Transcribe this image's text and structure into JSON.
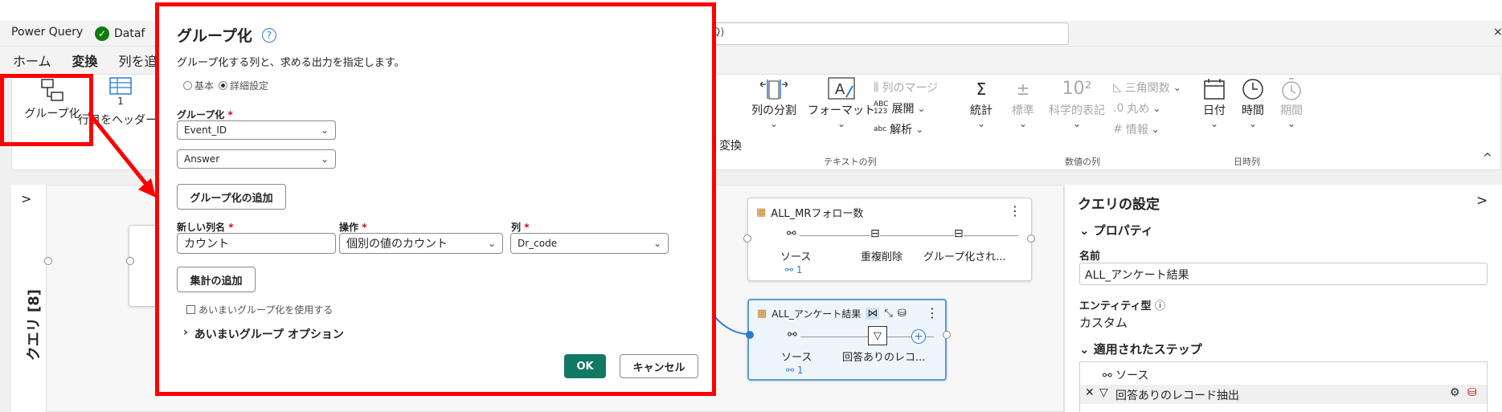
{
  "titlebar": {
    "app_tab": "Power Query",
    "doc_tab": "Dataf",
    "search_hint": "+ Q)",
    "close": "×"
  },
  "menu": {
    "items": [
      "ホーム",
      "変換",
      "列を追"
    ],
    "active_index": 1
  },
  "ribbon": {
    "group_by": "グループ化",
    "use_headers_partial": "行目をヘッダー",
    "use_headers_num": "1",
    "convert_partial": "変換",
    "split_column": "列の分割",
    "format": "フォーマット",
    "merge_columns": "列のマージ",
    "extract": "展開",
    "parse": "解析",
    "text_group": "テキストの列",
    "statistics": "統計",
    "standard": "標準",
    "scientific": "科学的表記",
    "trig": "三角関数",
    "rounding": "丸め",
    "information": "情報",
    "number_group": "数値の列",
    "date": "日付",
    "time": "時間",
    "duration": "期間",
    "datetime_group": "日時列",
    "collapse": "^"
  },
  "left_pane": {
    "label": "クエリ [8]",
    "expand": ">"
  },
  "nodes": {
    "mr": {
      "title": "ALL_MRフォロー数",
      "steps": [
        "ソース",
        "重複削除",
        "グループ化され..."
      ],
      "link_count": "1",
      "menu": "⋮"
    },
    "survey": {
      "title": "ALL_アンケート結果",
      "steps": [
        "ソース",
        "回答ありのレコ..."
      ],
      "link_count": "1",
      "menu": "⋮"
    }
  },
  "settings": {
    "title": "クエリの設定",
    "expand": ">",
    "properties": "プロパティ",
    "name_label": "名前",
    "name_value": "ALL_アンケート結果",
    "entity_label": "エンティティ型",
    "entity_value": "カスタム",
    "applied_steps": "適用されたステップ",
    "steps": [
      "ソース",
      "回答ありのレコード抽出"
    ]
  },
  "dialog": {
    "title": "グループ化",
    "subtitle": "グループ化する列と、求める出力を指定します。",
    "radio_basic": "基本",
    "radio_advanced": "詳細設定",
    "group_label": "グループ化",
    "group_col1": "Event_ID",
    "group_col2": "Answer",
    "add_grouping": "グループ化の追加",
    "new_col_label": "新しい列名",
    "op_label": "操作",
    "col_label": "列",
    "new_col_value": "カウント",
    "op_value": "個別の値のカウント",
    "col_value": "Dr_code",
    "add_aggregation": "集計の追加",
    "fuzzy_check": "あいまいグループ化を使用する",
    "fuzzy_options": "あいまいグループ オプション",
    "ok": "OK",
    "cancel": "キャンセル",
    "required": "*"
  },
  "colors": {
    "highlight": "#ff0000",
    "ok_button": "#117865",
    "accent": "#2d7bd6"
  }
}
